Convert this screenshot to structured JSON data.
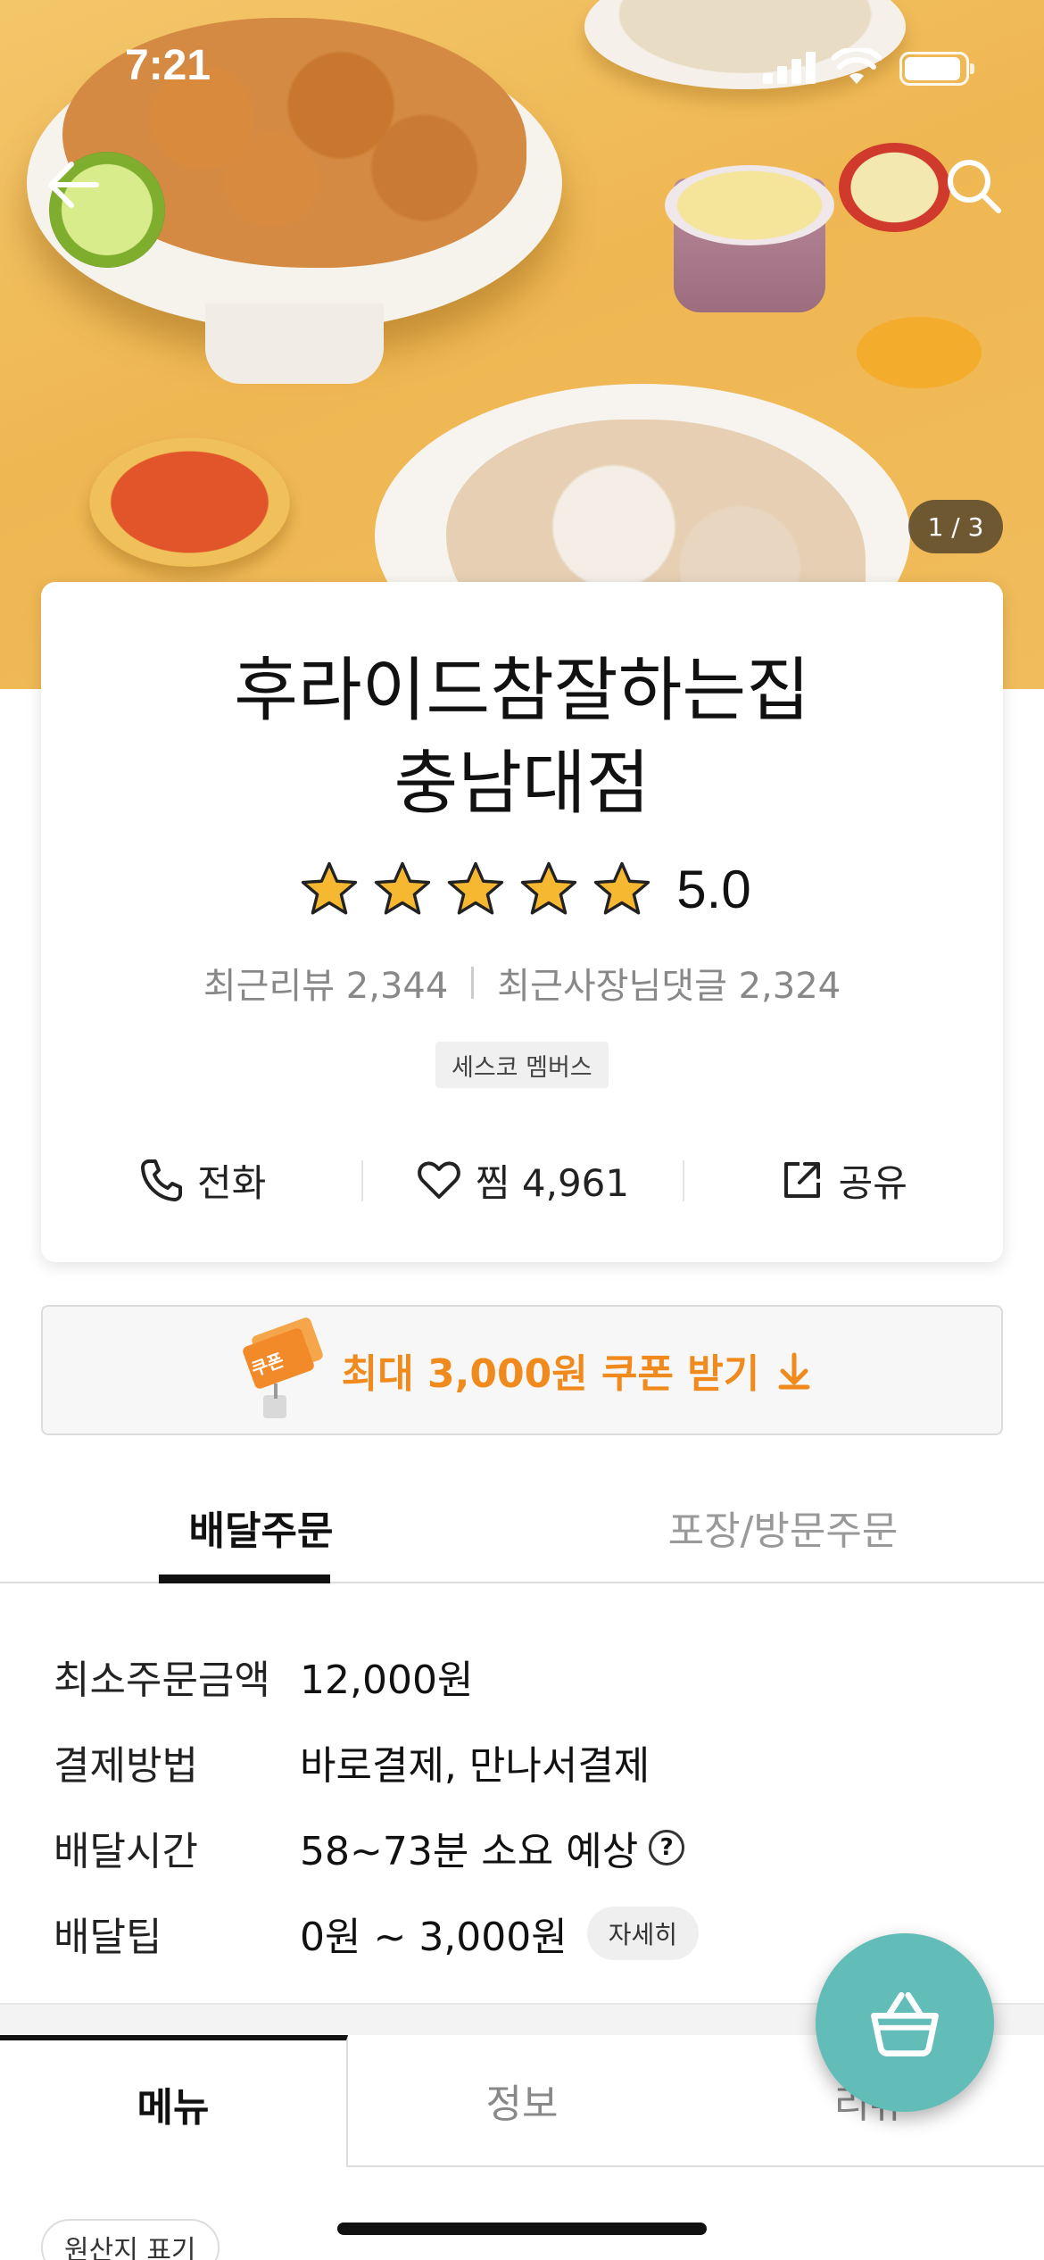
{
  "status_bar": {
    "time": "7:21"
  },
  "hero": {
    "image_counter": "1 / 3"
  },
  "store": {
    "name_line1": "후라이드참잘하는집",
    "name_line2": "충남대점",
    "rating": "5.0",
    "stars": 5,
    "recent_reviews": "최근리뷰 2,344",
    "recent_owner_replies": "최근사장님댓글 2,324",
    "badge": "세스코 멤버스"
  },
  "actions": {
    "call": "전화",
    "favorite": "찜 4,961",
    "share": "공유"
  },
  "coupon": {
    "label": "최대 3,000원 쿠폰 받기",
    "graphic_text": "쿠폰"
  },
  "order_tabs": {
    "delivery": "배달주문",
    "pickup": "포장/방문주문"
  },
  "delivery_info": {
    "min_order_label": "최소주문금액",
    "min_order_value": "12,000원",
    "payment_label": "결제방법",
    "payment_value": "바로결제, 만나서결제",
    "time_label": "배달시간",
    "time_value": "58~73분 소요 예상",
    "tip_label": "배달팁",
    "tip_value": "0원 ~ 3,000원",
    "tip_detail": "자세히"
  },
  "menu_tabs": {
    "menu": "메뉴",
    "info": "정보",
    "review": "리뷰"
  },
  "origin_label": "원산지 표기",
  "colors": {
    "accent_orange": "#f08a1c",
    "cart_teal": "#62bdb9",
    "star_gold": "#f6b830"
  }
}
